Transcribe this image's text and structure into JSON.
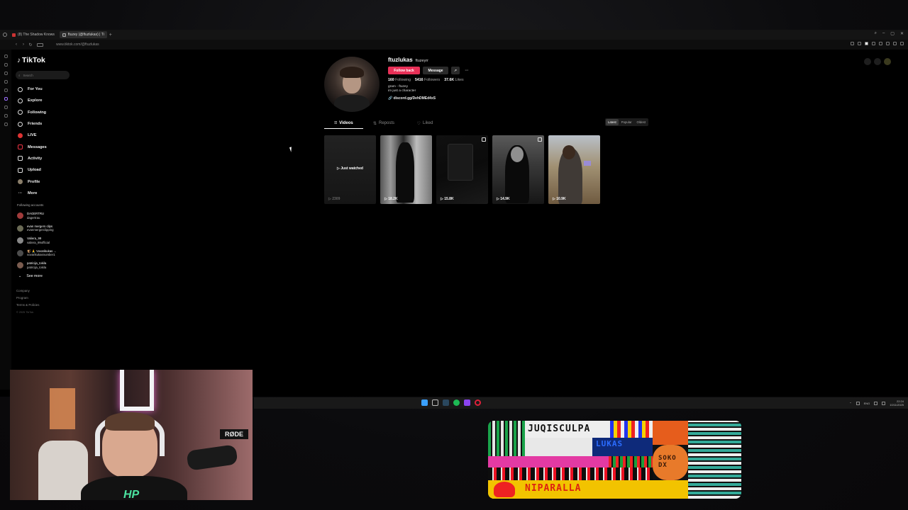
{
  "browser": {
    "tabs": [
      {
        "label": "(8) The Shadow Knows"
      },
      {
        "label": "ftuzey (@ftuzlukas) | Ti"
      }
    ],
    "new_tab_glyph": "+",
    "url": "www.tiktok.com/@ftuzlukas"
  },
  "tiktok": {
    "brand": "TikTok",
    "search_placeholder": "Search",
    "menu": [
      {
        "label": "For You",
        "icon": "home-icon"
      },
      {
        "label": "Explore",
        "icon": "compass-icon"
      },
      {
        "label": "Following",
        "icon": "following-icon"
      },
      {
        "label": "Friends",
        "icon": "friends-icon"
      },
      {
        "label": "LIVE",
        "icon": "live-icon"
      },
      {
        "label": "Messages",
        "icon": "messages-icon"
      },
      {
        "label": "Activity",
        "icon": "activity-icon"
      },
      {
        "label": "Upload",
        "icon": "upload-icon"
      },
      {
        "label": "Profile",
        "icon": "profile-avatar"
      },
      {
        "label": "More",
        "icon": "more-icon"
      }
    ],
    "following_title": "Following accounts",
    "accounts": [
      {
        "name": "DAGERTRU",
        "handle": "dagertrau"
      },
      {
        "name": "evan mergers clips",
        "handle": "evanmergerclipping"
      },
      {
        "name": "Valiera_99",
        "handle": "valiera_99official"
      },
      {
        "name": "🐒 🙏 Vovarikukas ...",
        "handle": "vovarikukasnumber1"
      },
      {
        "name": "patricija_tokila",
        "handle": "patricija_tokila"
      }
    ],
    "see_more": "See more",
    "footer": [
      "Company",
      "Program",
      "Terms & Policies"
    ],
    "copyright": "© 2025 TikTok"
  },
  "profile": {
    "handle": "ftuzlukas",
    "nickname": "ftuzeyrr",
    "follow_back": "Follow back",
    "message": "Message",
    "share_glyph": "↗",
    "more_glyph": "···",
    "following_count": "160",
    "following_label": "Following",
    "followers_count": "5416",
    "followers_label": "Followers",
    "likes_count": "37.6K",
    "likes_label": "Likes",
    "bio_line1": "gram - ftuzey",
    "bio_line2": "im just a character",
    "link": "discord.gg/DehDMEd4xS",
    "tabs": [
      "Videos",
      "Reposts",
      "Liked"
    ],
    "sort": [
      "Latest",
      "Popular",
      "Oldest"
    ],
    "videos": [
      {
        "overlay": "Just watched",
        "views": "2309"
      },
      {
        "views": "18.2K"
      },
      {
        "views": "15.8K"
      },
      {
        "views": "14.9K"
      },
      {
        "views": "10.9K"
      }
    ]
  },
  "taskbar": {
    "lang": "ENG",
    "time": "22:24",
    "date": "10/11/2025"
  },
  "webcam": {
    "mic_brand": "RØDE",
    "shirt_logo": "HP"
  },
  "pixel_art": {
    "text_top": "JUQISCULPA",
    "text_mid": "LUKAS",
    "text_sign": "SOKO DX",
    "text_bottom": "NIPARALLA"
  }
}
